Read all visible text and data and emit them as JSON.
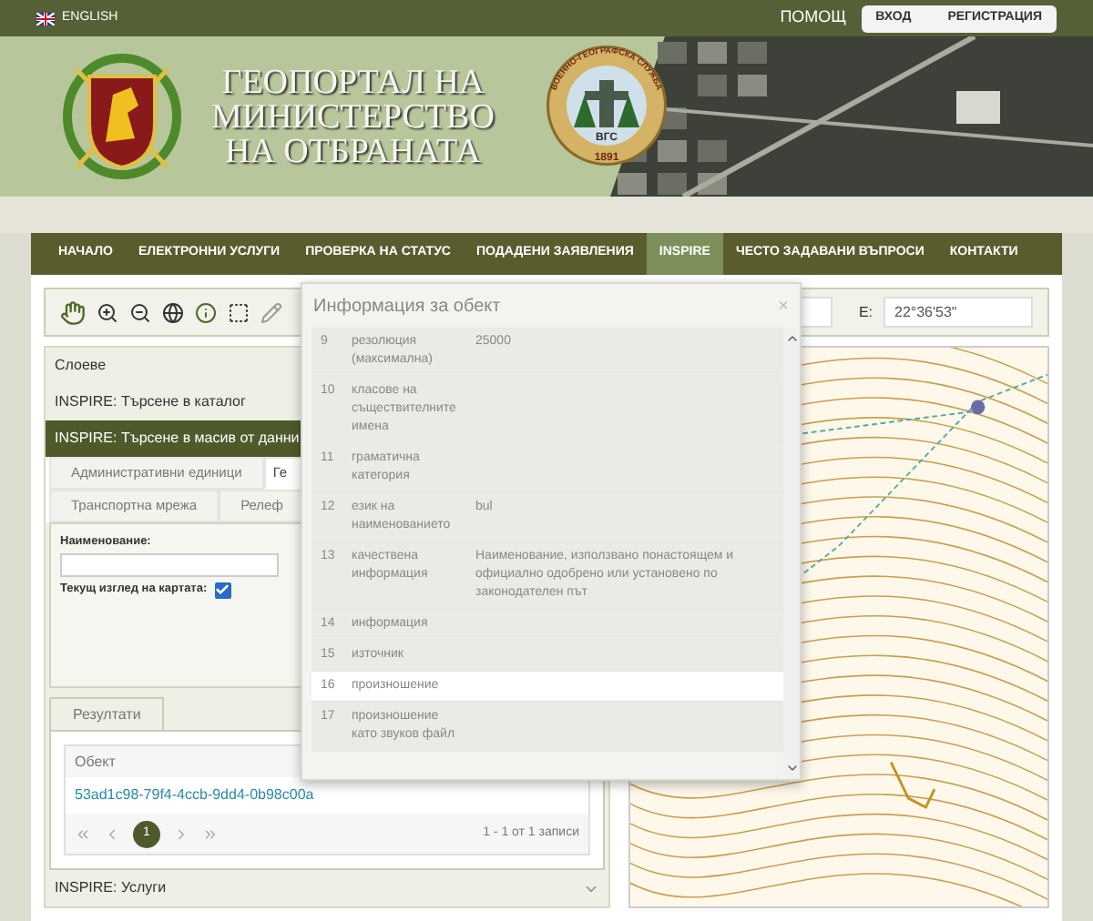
{
  "top_bar": {
    "language": "ENGLISH",
    "help": "ПОМОЩ",
    "buttons": [
      "ВХОД",
      "РЕГИСТРАЦИЯ"
    ]
  },
  "header": {
    "title_lines": [
      "ГЕОПОРТАЛ НА",
      "МИНИСТЕРСТВО",
      "НА ОТБРАНАТА"
    ],
    "emblem_ring": "ВОЕННО-ГЕОГРАФСКА СЛУЖБА",
    "emblem_abbr": "ВГС",
    "emblem_year": "1891"
  },
  "nav": [
    {
      "label": "НАЧАЛО",
      "selected": false
    },
    {
      "label": "ЕЛЕКТРОННИ УСЛУГИ",
      "selected": false
    },
    {
      "label": "ПРОВЕРКА НА СТАТУС",
      "selected": false
    },
    {
      "label": "ПОДАДЕНИ ЗАЯВЛЕНИЯ",
      "selected": false
    },
    {
      "label": "INSPIRE",
      "selected": true
    },
    {
      "label": "ЧЕСТО ЗАДАВАНИ ВЪПРОСИ",
      "selected": false
    },
    {
      "label": "КОНТАКТИ",
      "selected": false
    }
  ],
  "toolbar": {
    "e_label": "E:",
    "e_value": "22°36'53\""
  },
  "sidebar": {
    "sections": [
      {
        "label": "Слоеве",
        "selected": false
      },
      {
        "label": "INSPIRE: Търсене в каталог",
        "selected": false
      },
      {
        "label": "INSPIRE: Търсене в масив от данни",
        "selected": true
      }
    ],
    "tabs": [
      [
        {
          "label": "Административни единици",
          "selected": false
        },
        {
          "label": "Ге",
          "selected": true
        }
      ],
      [
        {
          "label": "Транспортна мрежа",
          "selected": false
        },
        {
          "label": "Релеф",
          "selected": false
        }
      ]
    ],
    "form": {
      "name_label": "Наименование:",
      "view_label": "Текущ изглед на картата:",
      "view_checked": true
    },
    "results": {
      "tab": "Резултати",
      "column": "Обект",
      "row": "53ad1c98-79f4-4ccb-9dd4-0b98c00a",
      "pages": [
        {
          "label": "1",
          "selected": true
        }
      ],
      "summary": "1 - 1 от 1 записи"
    },
    "footer_section": "INSPIRE: Услуги"
  },
  "popup": {
    "title": "Информация за обект",
    "close": "×",
    "rows": [
      {
        "num": "9",
        "name": "резолюция (максимална)",
        "value": "25000",
        "hovered": false
      },
      {
        "num": "10",
        "name": "класове на съществителните имена",
        "hovered": false
      },
      {
        "num": "11",
        "name": "граматична категория",
        "hovered": false
      },
      {
        "num": "12",
        "name": "език на наименованието",
        "value": "bul",
        "hovered": false
      },
      {
        "num": "13",
        "name": "качествена информация",
        "value": "Наименование, използвано понастоящем и официално одобрено или установено по законодателен път",
        "hovered": false
      },
      {
        "num": "14",
        "name": "информация",
        "hovered": false
      },
      {
        "num": "15",
        "name": "източник",
        "hovered": false
      },
      {
        "num": "16",
        "name": "произношение",
        "hovered": true
      },
      {
        "num": "17",
        "name": "произношение като звуков файл",
        "hovered": false
      }
    ]
  }
}
